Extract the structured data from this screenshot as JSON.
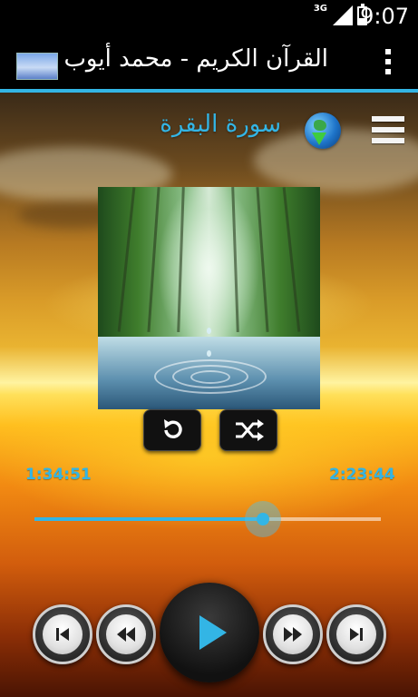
{
  "status_bar": {
    "network": "3G",
    "time": "9:07"
  },
  "action_bar": {
    "title": "القرآن الكريم - محمد أيوب"
  },
  "player": {
    "surah_title": "سورة البقرة",
    "elapsed": "1:34:51",
    "duration": "2:23:44",
    "progress_fraction": 0.66
  },
  "colors": {
    "accent": "#33b5e5",
    "action_bar_bg": "#000000"
  },
  "icons": {
    "repeat": "repeat-icon",
    "shuffle": "shuffle-icon",
    "previous": "skip-previous-icon",
    "rewind": "rewind-icon",
    "play": "play-icon",
    "forward": "fast-forward-icon",
    "next": "skip-next-icon",
    "menu": "menu-icon",
    "globe": "globe-download-icon",
    "overflow": "overflow-menu-icon"
  }
}
